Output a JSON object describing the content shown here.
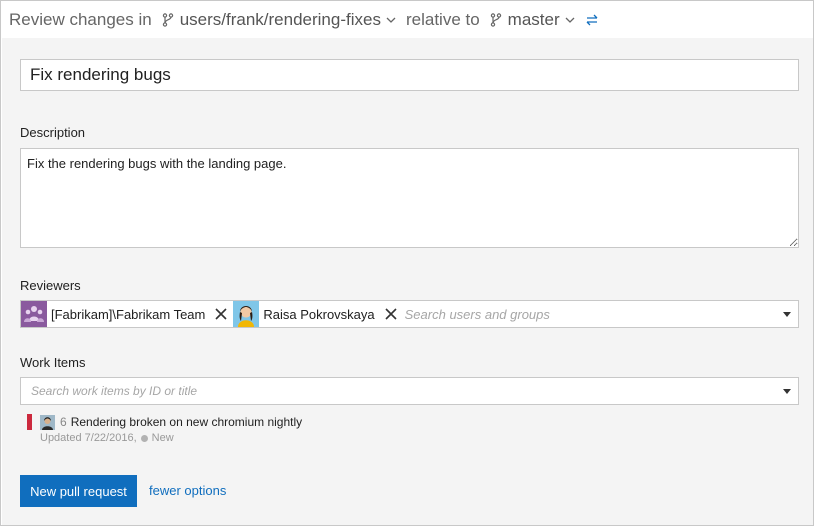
{
  "header": {
    "prefix": "Review changes in",
    "source_branch": "users/frank/rendering-fixes",
    "relative_label": "relative to",
    "target_branch": "master"
  },
  "form": {
    "title_value": "Fix rendering bugs",
    "description_label": "Description",
    "description_value": "Fix the rendering bugs with the landing page.",
    "reviewers_label": "Reviewers",
    "reviewers": [
      {
        "name": "[Fabrikam]\\Fabrikam Team",
        "avatar": "team-avatar-icon"
      },
      {
        "name": "Raisa Pokrovskaya",
        "avatar": "user-avatar-icon"
      }
    ],
    "reviewers_placeholder": "Search users and groups",
    "workitems_label": "Work Items",
    "workitems_placeholder": "Search work items by ID or title",
    "work_items": [
      {
        "id": "6",
        "title": "Rendering broken on new chromium nightly",
        "updated": "Updated 7/22/2016,",
        "state": "New"
      }
    ]
  },
  "actions": {
    "create_label": "New pull request",
    "fewer_label": "fewer options"
  },
  "colors": {
    "accent": "#106ebe",
    "bug_red": "#cc293d",
    "panel_bg": "#f4f4f4"
  }
}
